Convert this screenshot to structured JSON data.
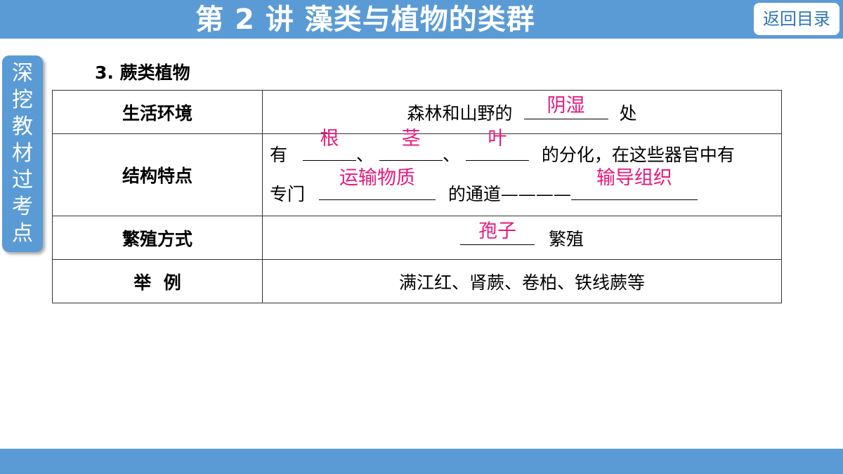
{
  "header": {
    "title": "第 2 讲 藻类与植物的类群",
    "back_button": "返回目录"
  },
  "side_tab": {
    "chars": [
      "深",
      "挖",
      "教",
      "材",
      "过",
      "考",
      "点"
    ]
  },
  "section": {
    "heading": "3.  蕨类植物"
  },
  "table": {
    "row1": {
      "label": "生活环境",
      "before": "森林和山野的",
      "answer": "阴湿",
      "after": "处"
    },
    "row2": {
      "label": "结构特点",
      "w_you": "有",
      "a1": "根",
      "sep1": "、",
      "a2": "茎",
      "sep2": "、",
      "a3": "叶",
      "tail1": "的分化，在这些器官中有",
      "w_zhuanmen": "专门",
      "a4": "运输物质",
      "mid": "的通道————",
      "a5": "输导组织"
    },
    "row3": {
      "label": "繁殖方式",
      "answer": "孢子",
      "after": "繁殖"
    },
    "row4": {
      "label": "举  例",
      "content": "满江红、肾蕨、卷柏、铁线蕨等"
    }
  },
  "colors": {
    "theme_blue": "#5b9bd5",
    "answer_pink": "#e6197d"
  }
}
